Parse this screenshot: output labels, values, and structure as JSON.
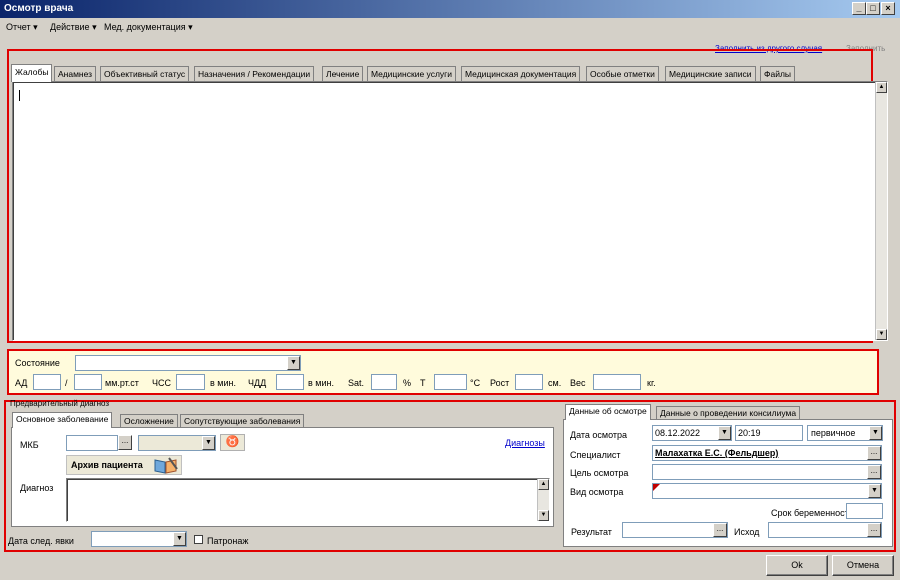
{
  "window": {
    "title": "Осмотр врача"
  },
  "menu": {
    "items": [
      "Отчет ▾",
      "Действие ▾",
      "Мед. документация ▾"
    ]
  },
  "toolbar": {
    "fill_from_case": "Заполнить из другого случая",
    "fill": "Заполнить"
  },
  "tabs": [
    "Жалобы",
    "Анамнез",
    "Объективный статус",
    "Назначения / Рекомендации",
    "Лечение",
    "Медицинские услуги",
    "Медицинская документация",
    "Особые отметки",
    "Медицинские записи",
    "Файлы"
  ],
  "vitals": {
    "condition_label": "Состояние",
    "ad_label": "АД",
    "ad_sep": "/",
    "ad_unit": "мм.рт.ст",
    "hr_label": "ЧСС",
    "hr_unit": "в мин.",
    "rr_label": "ЧДД",
    "rr_unit": "в мин.",
    "sat_label": "Sat.",
    "sat_unit": "%",
    "t_label": "Т",
    "t_unit": "°С",
    "height_label": "Рост",
    "height_unit": "см.",
    "weight_label": "Вес",
    "weight_unit": "кг."
  },
  "diagnosis": {
    "group_title": "Предварительный диагноз",
    "tabs": [
      "Основное заболевание",
      "Осложнение",
      "Сопутствующие заболевания"
    ],
    "mkb_label": "МКБ",
    "diagnoses_link": "Диагнозы",
    "archive_button": "Архив пациента",
    "diagnosis_label": "Диагноз",
    "next_visit_label": "Дата след. явки",
    "patronage_label": "Патронаж"
  },
  "exam": {
    "tabs": [
      "Данные об осмотре",
      "Данные о проведении консилиума"
    ],
    "date_label": "Дата осмотра",
    "date_value": "08.12.2022",
    "time_value": "20:19",
    "type_value": "первичное",
    "specialist_label": "Специалист",
    "specialist_value": "Малахатка Е.С. (Фельдшер)",
    "purpose_label": "Цель осмотра",
    "kind_label": "Вид осмотра",
    "pregnancy_label": "Срок беременности",
    "result_label": "Результат",
    "outcome_label": "Исход"
  },
  "buttons": {
    "ok": "Ok",
    "cancel": "Отмена"
  },
  "colors": {
    "highlight": "#e00000",
    "vitals_bg": "#fffbdc",
    "title_start": "#0a246a"
  }
}
